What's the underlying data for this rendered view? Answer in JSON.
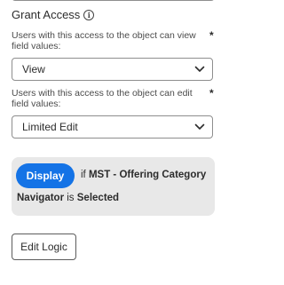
{
  "grant_access": {
    "title": "Grant Access",
    "info_icon": "info-icon"
  },
  "view_field": {
    "label": "Users with this access to the object can view field values:",
    "required_mark": "*",
    "selected": "View"
  },
  "edit_field": {
    "label": "Users with this access to the object can edit field values:",
    "required_mark": "*",
    "selected": "Limited Edit"
  },
  "rule": {
    "action_label": "Display",
    "if_word": "if",
    "field_name_line1": "MST - Offering Category",
    "field_name_line2": "Navigator",
    "is_word": "is",
    "condition": "Selected"
  },
  "edit_logic_label": "Edit Logic",
  "colors": {
    "accent": "#1473e6",
    "card_background": "#e8e8e8",
    "border": "#8e8e8e"
  }
}
